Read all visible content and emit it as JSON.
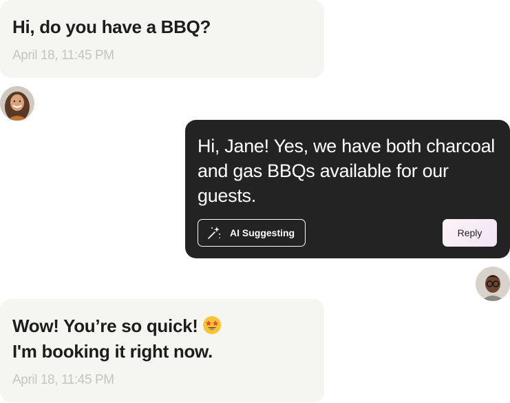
{
  "messages": [
    {
      "text": "Hi, do you have a BBQ?",
      "time": "April 18, 11:45 PM"
    },
    {
      "text": "Hi, Jane! Yes, we have both charcoal and gas BBQs available for our guests.",
      "ai_label": "AI Suggesting",
      "reply_label": "Reply"
    },
    {
      "line1": "Wow! You’re so quick!",
      "line2": "I'm booking it right now.",
      "time": "April 18, 11:45 PM"
    }
  ],
  "icons": {
    "ai": "magic-wand-icon",
    "emoji": "star-struck-emoji"
  },
  "colors": {
    "incoming_bubble": "#f5f5f1",
    "outgoing_bubble": "#232323",
    "timestamp": "#c4c4c2"
  }
}
